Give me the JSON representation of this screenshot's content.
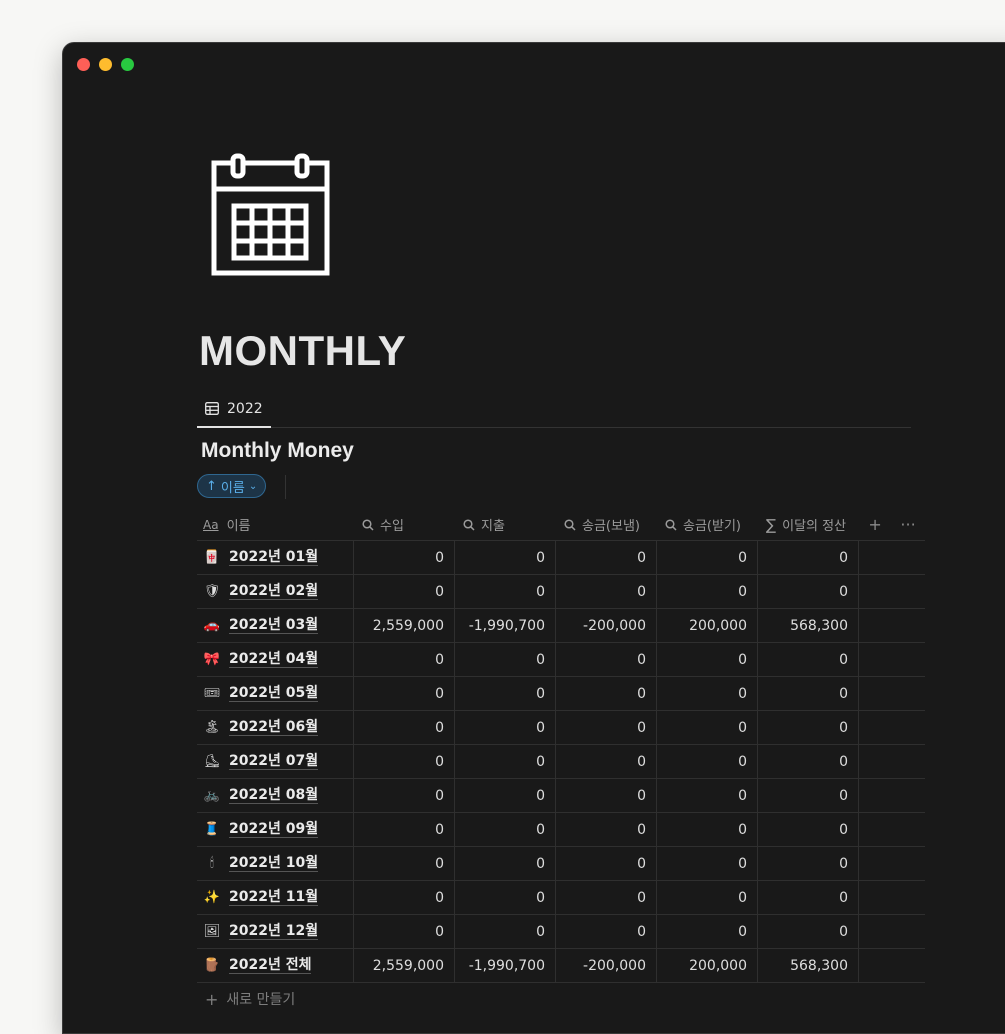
{
  "page": {
    "title": "MONTHLY",
    "icon": "calendar-icon"
  },
  "view_tab": {
    "label": "2022",
    "icon": "table-icon"
  },
  "database": {
    "title": "Monthly Money"
  },
  "sort": {
    "label": "이름",
    "direction": "ascending"
  },
  "columns": [
    {
      "label": "이름",
      "type_icon": "Aa"
    },
    {
      "label": "수입",
      "type_icon": "search-icon"
    },
    {
      "label": "지출",
      "type_icon": "search-icon"
    },
    {
      "label": "송금(보냄)",
      "type_icon": "search-icon"
    },
    {
      "label": "송금(받기)",
      "type_icon": "search-icon"
    },
    {
      "label": "이달의 정산",
      "type_icon": "sigma-icon"
    }
  ],
  "header_actions": {
    "add": "+",
    "more": "···"
  },
  "rows": [
    {
      "icon": "🀄",
      "name": "2022년 01월",
      "income": "0",
      "expense": "0",
      "sent": "0",
      "received": "0",
      "settlement": "0"
    },
    {
      "icon": "🛡",
      "name": "2022년 02월",
      "income": "0",
      "expense": "0",
      "sent": "0",
      "received": "0",
      "settlement": "0"
    },
    {
      "icon": "🚗",
      "name": "2022년 03월",
      "income": "2,559,000",
      "expense": "-1,990,700",
      "sent": "-200,000",
      "received": "200,000",
      "settlement": "568,300"
    },
    {
      "icon": "🎀",
      "name": "2022년 04월",
      "income": "0",
      "expense": "0",
      "sent": "0",
      "received": "0",
      "settlement": "0"
    },
    {
      "icon": "🎟",
      "name": "2022년 05월",
      "income": "0",
      "expense": "0",
      "sent": "0",
      "received": "0",
      "settlement": "0"
    },
    {
      "icon": "🏝",
      "name": "2022년 06월",
      "income": "0",
      "expense": "0",
      "sent": "0",
      "received": "0",
      "settlement": "0"
    },
    {
      "icon": "⛸",
      "name": "2022년 07월",
      "income": "0",
      "expense": "0",
      "sent": "0",
      "received": "0",
      "settlement": "0"
    },
    {
      "icon": "🚲",
      "name": "2022년 08월",
      "income": "0",
      "expense": "0",
      "sent": "0",
      "received": "0",
      "settlement": "0"
    },
    {
      "icon": "🧵",
      "name": "2022년 09월",
      "income": "0",
      "expense": "0",
      "sent": "0",
      "received": "0",
      "settlement": "0"
    },
    {
      "icon": "🕯",
      "name": "2022년 10월",
      "income": "0",
      "expense": "0",
      "sent": "0",
      "received": "0",
      "settlement": "0"
    },
    {
      "icon": "✨",
      "name": "2022년 11월",
      "income": "0",
      "expense": "0",
      "sent": "0",
      "received": "0",
      "settlement": "0"
    },
    {
      "icon": "🖼",
      "name": "2022년 12월",
      "income": "0",
      "expense": "0",
      "sent": "0",
      "received": "0",
      "settlement": "0"
    },
    {
      "icon": "🪵",
      "name": "2022년 전체",
      "income": "2,559,000",
      "expense": "-1,990,700",
      "sent": "-200,000",
      "received": "200,000",
      "settlement": "568,300"
    }
  ],
  "new_row": {
    "label": "새로 만들기"
  },
  "colors": {
    "background": "#191919",
    "sort_accent": "#5aaee8"
  }
}
